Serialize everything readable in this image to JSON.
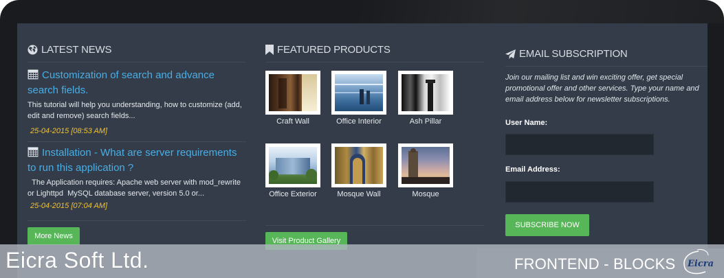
{
  "news": {
    "title": "LATEST NEWS",
    "items": [
      {
        "title": "Customization of search and advance search fields.",
        "desc": "This tutorial will help you understanding, how to customize (add, edit and remove) search fields...",
        "date": "25-04-2015 [08:53 AM]"
      },
      {
        "title": "Installation - What are server requirements to run this application ?",
        "desc": "  The Application requires: Apache web server with mod_rewrite or Lighttpd  MySQL database server, version 5.0 or...",
        "date": "25-04-2015 [07:04 AM]"
      }
    ],
    "more_label": "More News"
  },
  "products": {
    "title": "FEATURED PRODUCTS",
    "items": [
      {
        "label": "Craft Wall"
      },
      {
        "label": "Office Interior"
      },
      {
        "label": "Ash Pillar"
      },
      {
        "label": "Office Exterior"
      },
      {
        "label": "Mosque Wall"
      },
      {
        "label": "Mosque"
      }
    ],
    "gallery_label": "Visit Product Gallery"
  },
  "email": {
    "title": "EMAIL SUBSCRIPTION",
    "intro": "Join our mailing list and win exciting offer, get special promotional offer and other services. Type your name and email address below for newsletter subscriptions.",
    "username_label": "User Name:",
    "email_label": "Email Address:",
    "username_value": "",
    "email_value": "",
    "subscribe_label": "SUBSCRIBE NOW"
  },
  "banner": {
    "brand": "Eicra Soft Ltd.",
    "label": "FRONTEND - BLOCKS",
    "logo_text": "Eicra"
  },
  "colors": {
    "panel": "#333c48",
    "link": "#4aaee6",
    "date": "#f2c230",
    "button": "#57b658"
  },
  "icons": {
    "news": "globe-icon",
    "products": "bookmark-icon",
    "email": "paper-plane-icon",
    "news_item": "calendar-icon"
  }
}
